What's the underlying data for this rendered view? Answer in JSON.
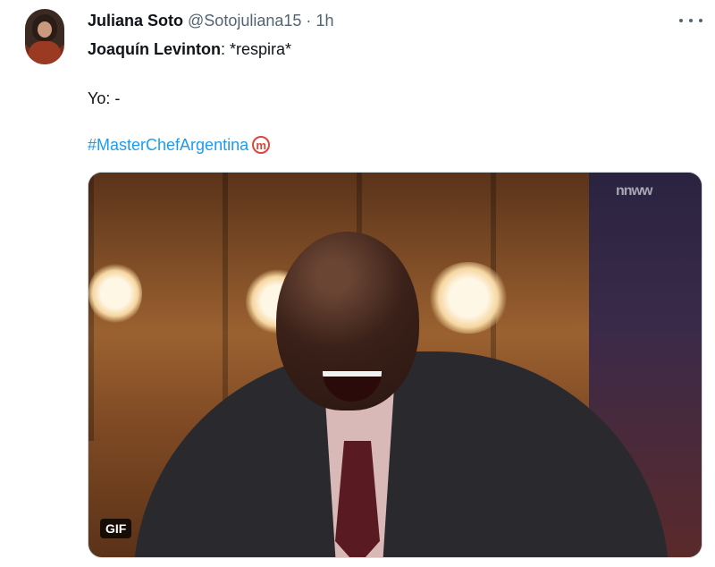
{
  "tweet": {
    "author_name": "Juliana Soto",
    "author_handle": "@Sotojuliana15",
    "separator": "·",
    "time": "1h",
    "mention_name": "Joaquín Levinton",
    "line1_rest": ": *respira*",
    "line2": "Yo: -",
    "hashtag": "#MasterChefArgentina",
    "hashtag_emoji_icon": "masterchef-m-icon"
  },
  "media": {
    "badge": "GIF",
    "watermark": "nnww"
  },
  "colors": {
    "link": "#1d9bf0",
    "secondary_text": "#536471",
    "primary_text": "#0f1419"
  }
}
